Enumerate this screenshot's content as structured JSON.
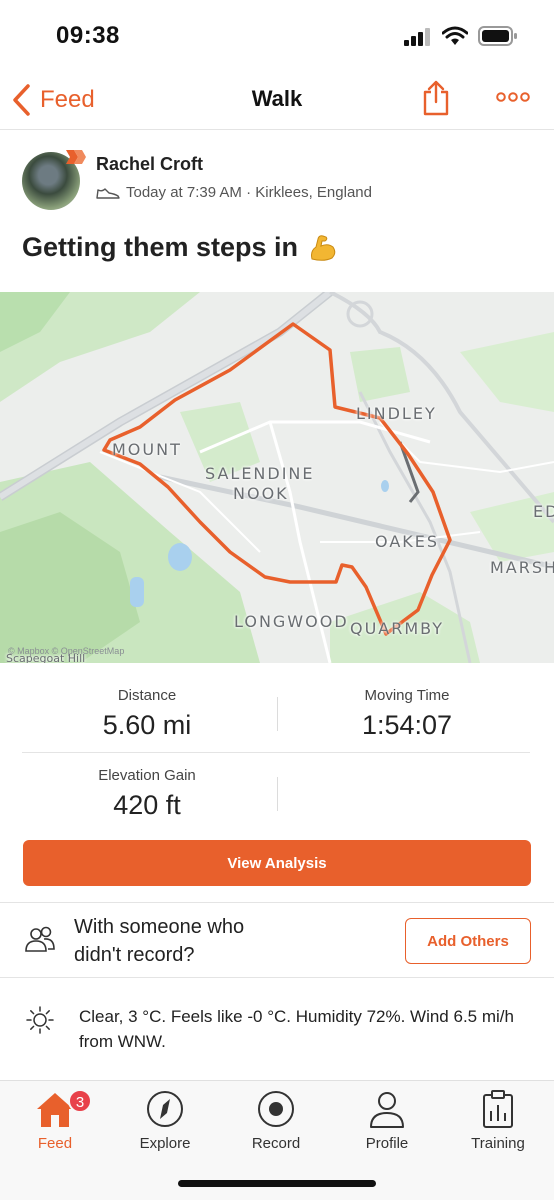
{
  "status": {
    "time": "09:38"
  },
  "nav": {
    "back_label": "Feed",
    "title": "Walk"
  },
  "athlete": {
    "name": "Rachel Croft",
    "meta": "Today at 7:39 AM · Kirklees, England"
  },
  "activity": {
    "title": "Getting them steps in",
    "emoji_icon": "flexed-biceps-icon"
  },
  "map": {
    "labels": {
      "lindley": "LINDLEY",
      "mount": "MOUNT",
      "salendine": "SALENDINE",
      "nook": "NOOK",
      "oakes": "OAKES",
      "ed": "ED",
      "marsh": "MARSH",
      "longwood": "LONGWOOD",
      "quarmby": "QUARMBY",
      "scapegoat": "Scapegoat Hill"
    },
    "attribution": "© Mapbox © OpenStreetMap",
    "route_color": "#e8602c"
  },
  "stats": {
    "distance": {
      "label": "Distance",
      "value": "5.60 mi"
    },
    "moving_time": {
      "label": "Moving Time",
      "value": "1:54:07"
    },
    "elevation": {
      "label": "Elevation Gain",
      "value": "420 ft"
    }
  },
  "actions": {
    "view_analysis": "View Analysis",
    "with_someone": "With someone who didn't record?",
    "add_others": "Add Others"
  },
  "weather": {
    "text": "Clear, 3 °C. Feels like -0 °C. Humidity 72%. Wind 6.5 mi/h from WNW."
  },
  "tabs": [
    {
      "label": "Feed",
      "icon": "home-icon",
      "badge": "3",
      "active": true
    },
    {
      "label": "Explore",
      "icon": "compass-icon"
    },
    {
      "label": "Record",
      "icon": "record-icon"
    },
    {
      "label": "Profile",
      "icon": "profile-icon"
    },
    {
      "label": "Training",
      "icon": "training-icon"
    }
  ],
  "colors": {
    "accent": "#e8602c",
    "badge": "#e8414a"
  }
}
